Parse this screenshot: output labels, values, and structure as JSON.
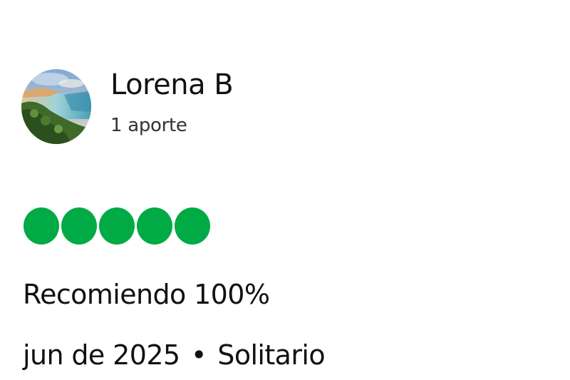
{
  "author": {
    "name": "Lorena B",
    "contributions": "1 aporte"
  },
  "rating": {
    "value": 5,
    "max": 5,
    "color": "#00aa44"
  },
  "review": {
    "title": "Recomiendo 100%",
    "date": "jun de 2025",
    "separator": "•",
    "trip_type": "Solitario"
  }
}
